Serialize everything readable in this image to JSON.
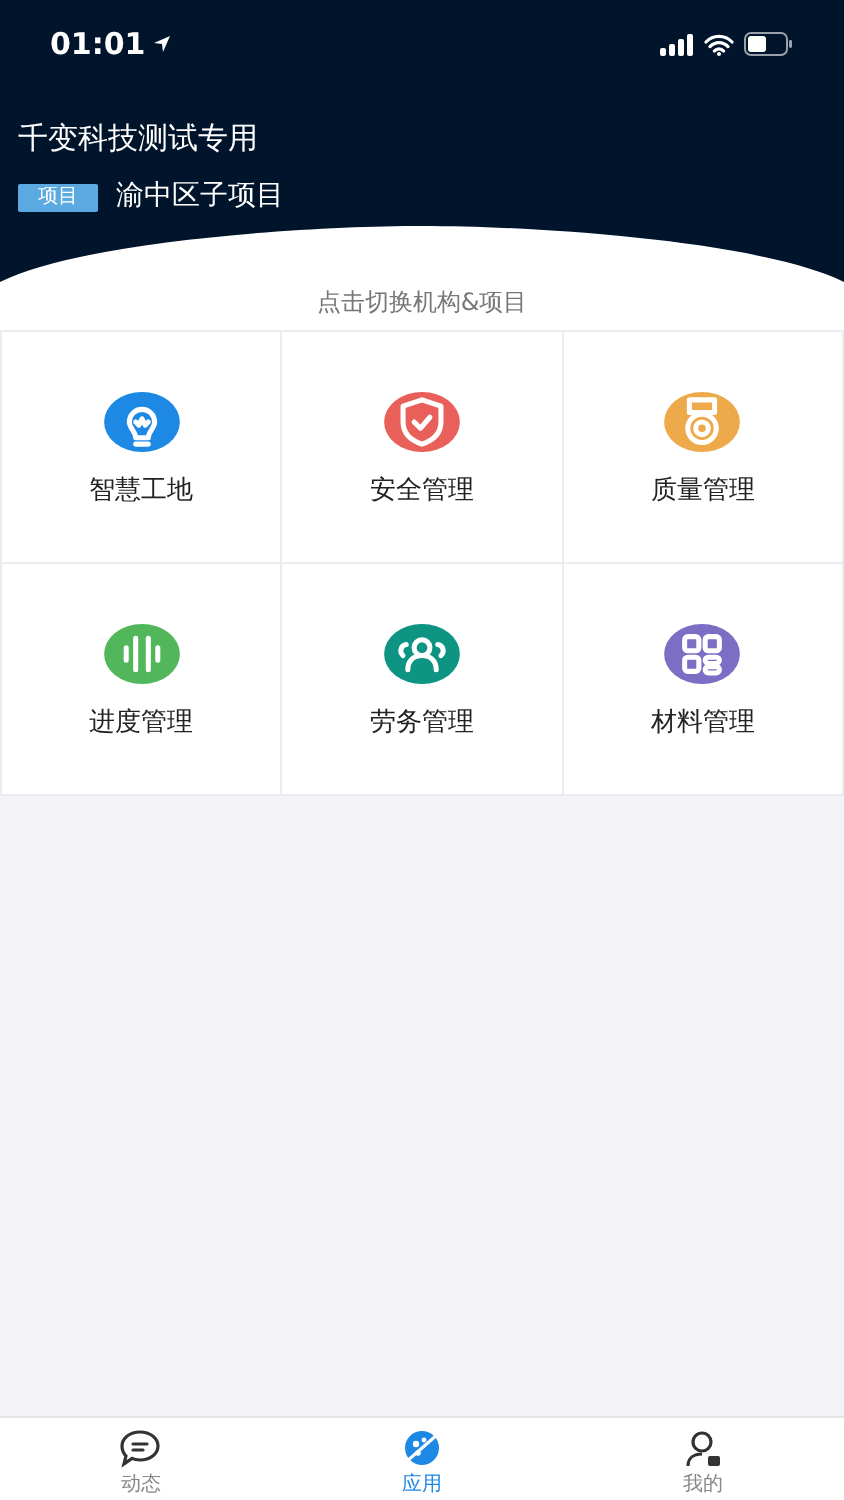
{
  "status_bar": {
    "time": "01:01"
  },
  "header": {
    "title": "千变科技测试专用",
    "tag": "项目",
    "project": "渝中区子项目"
  },
  "switch_hint": "点击切换机构&项目",
  "apps": [
    {
      "label": "智慧工地",
      "kind": "bulb",
      "color": "#1e88e5"
    },
    {
      "label": "安全管理",
      "kind": "shield",
      "color": "#e9605a"
    },
    {
      "label": "质量管理",
      "kind": "medal",
      "color": "#eea94a"
    },
    {
      "label": "进度管理",
      "kind": "bars",
      "color": "#52b65a"
    },
    {
      "label": "劳务管理",
      "kind": "people",
      "color": "#0d9483"
    },
    {
      "label": "材料管理",
      "kind": "grid",
      "color": "#7b6ec4"
    }
  ],
  "tab_bar": [
    {
      "label": "动态",
      "kind": "chat",
      "selected": false
    },
    {
      "label": "应用",
      "kind": "apps",
      "selected": true
    },
    {
      "label": "我的",
      "kind": "user",
      "selected": false
    }
  ]
}
